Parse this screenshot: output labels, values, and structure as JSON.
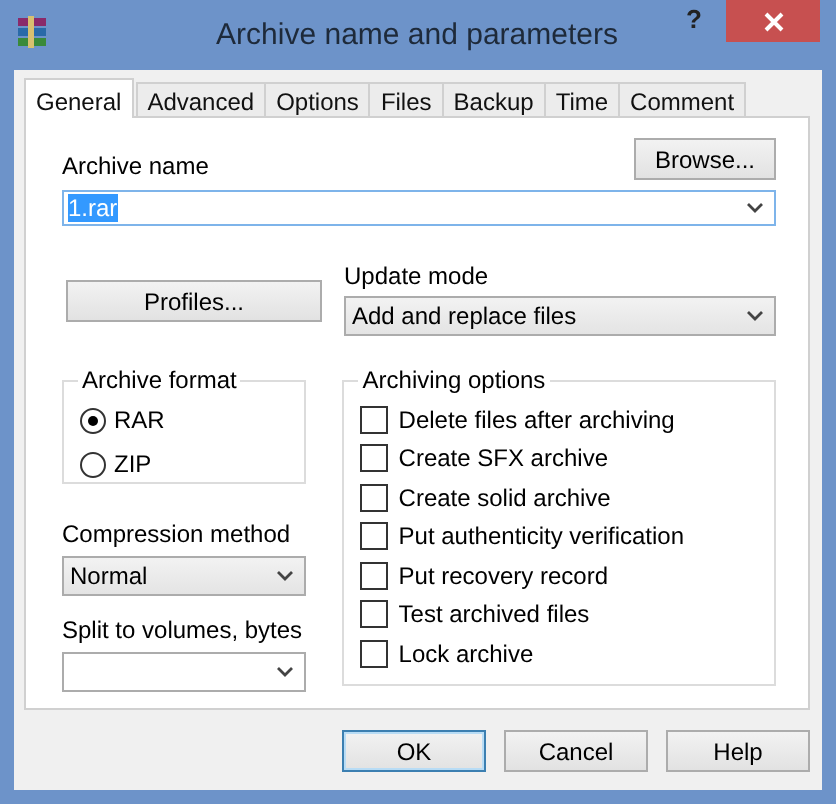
{
  "window": {
    "title": "Archive name and parameters",
    "help_button": "?"
  },
  "tabs": [
    {
      "label": "General",
      "selected": true
    },
    {
      "label": "Advanced",
      "selected": false
    },
    {
      "label": "Options",
      "selected": false
    },
    {
      "label": "Files",
      "selected": false
    },
    {
      "label": "Backup",
      "selected": false
    },
    {
      "label": "Time",
      "selected": false
    },
    {
      "label": "Comment",
      "selected": false
    }
  ],
  "archive_name": {
    "label": "Archive name",
    "value": "1.rar",
    "highlighted": true,
    "browse_button": "Browse..."
  },
  "profiles_button": "Profiles...",
  "update_mode": {
    "label": "Update mode",
    "value": "Add and replace files"
  },
  "archive_format": {
    "title": "Archive format",
    "options": [
      {
        "label": "RAR",
        "selected": true
      },
      {
        "label": "ZIP",
        "selected": false
      }
    ]
  },
  "compression_method": {
    "label": "Compression method",
    "value": "Normal"
  },
  "split_volumes": {
    "label": "Split to volumes, bytes"
  },
  "archiving_options": {
    "title": "Archiving options",
    "options": [
      {
        "label": "Delete files after archiving",
        "checked": false
      },
      {
        "label": "Create SFX archive",
        "checked": false
      },
      {
        "label": "Create solid archive",
        "checked": false
      },
      {
        "label": "Put authenticity verification",
        "checked": false
      },
      {
        "label": "Put recovery record",
        "checked": false
      },
      {
        "label": "Test archived files",
        "checked": false
      },
      {
        "label": "Lock archive",
        "checked": false
      }
    ]
  },
  "buttons": [
    {
      "label": "OK",
      "default": true
    },
    {
      "label": "Cancel",
      "default": false
    },
    {
      "label": "Help",
      "default": false
    }
  ]
}
